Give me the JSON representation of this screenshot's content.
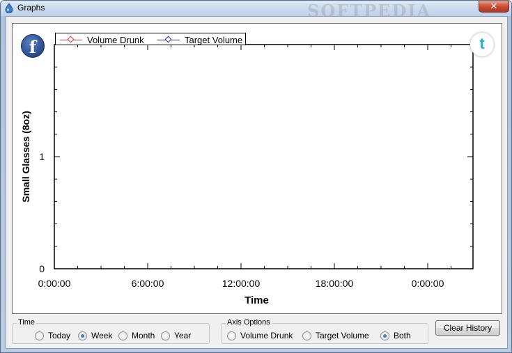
{
  "window": {
    "title": "Graphs",
    "close_label": "✕",
    "watermark": "SOFTPEDIA"
  },
  "social": {
    "facebook_glyph": "f",
    "twitter_glyph": "t"
  },
  "legend": {
    "items": [
      {
        "label": "Volume Drunk",
        "color": "#d43a3a"
      },
      {
        "label": "Target Volume",
        "color": "#2a2ab0"
      }
    ]
  },
  "chart_data": {
    "type": "line",
    "title": "",
    "xlabel": "Time",
    "ylabel": "Small Glasses (8oz)",
    "x_tick_labels": [
      "0:00:00",
      "6:00:00",
      "12:00:00",
      "18:00:00",
      "0:00:00"
    ],
    "y_tick_labels": [
      "0",
      "1"
    ],
    "ylim": [
      0,
      2
    ],
    "grid": false,
    "legend_position": "top-left",
    "series": [
      {
        "name": "Volume Drunk",
        "color": "#d43a3a",
        "values": []
      },
      {
        "name": "Target Volume",
        "color": "#2a2ab0",
        "values": []
      }
    ]
  },
  "controls": {
    "time_group": {
      "label": "Time",
      "options": [
        {
          "label": "Today",
          "checked": false
        },
        {
          "label": "Week",
          "checked": true
        },
        {
          "label": "Month",
          "checked": false
        },
        {
          "label": "Year",
          "checked": false
        }
      ]
    },
    "axis_group": {
      "label": "Axis Options",
      "options": [
        {
          "label": "Volume Drunk",
          "checked": false
        },
        {
          "label": "Target Volume",
          "checked": false
        },
        {
          "label": "Both",
          "checked": true
        }
      ]
    },
    "clear_label": "Clear History"
  }
}
